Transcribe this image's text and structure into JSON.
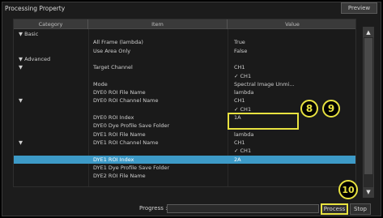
{
  "window": {
    "title": "Processing Property",
    "preview_label": "Preview"
  },
  "grid": {
    "headers": [
      "Category",
      "Item",
      "Value"
    ],
    "rows": [
      {
        "category": "▼ Basic",
        "item": "",
        "value": ""
      },
      {
        "category": "",
        "item": "All Frame (lambda)",
        "value": "True"
      },
      {
        "category": "",
        "item": "Use Area Only",
        "value": "False"
      },
      {
        "category": "▼ Advanced",
        "item": "",
        "value": ""
      },
      {
        "category": "▼",
        "item": "Target Channel",
        "value": "CH1"
      },
      {
        "category": "",
        "item": "",
        "value": "✓ CH1"
      },
      {
        "category": "",
        "item": "Mode",
        "value": "Spectral Image Unmi..."
      },
      {
        "category": "",
        "item": "DYE0  ROI File Name",
        "value": "lambda"
      },
      {
        "category": "▼",
        "item": "DYE0  ROI Channel Name",
        "value": "CH1"
      },
      {
        "category": "",
        "item": "",
        "value": "✓ CH1"
      },
      {
        "category": "",
        "item": "DYE0  ROI Index",
        "value": "1A"
      },
      {
        "category": "",
        "item": "DYE0 Dye Profile Save Folder",
        "value": ""
      },
      {
        "category": "",
        "item": "DYE1  ROI File Name",
        "value": "lambda"
      },
      {
        "category": "▼",
        "item": "DYE1  ROI Channel Name",
        "value": "CH1"
      },
      {
        "category": "",
        "item": "",
        "value": "✓ CH1"
      },
      {
        "category": "",
        "item": "DYE1  ROI Index",
        "value": "2A"
      },
      {
        "category": "",
        "item": "DYE1 Dye Profile Save Folder",
        "value": ""
      },
      {
        "category": "",
        "item": "DYE2  ROI File Name",
        "value": ""
      }
    ],
    "selected_row_index": 15
  },
  "callouts": {
    "c8": "8",
    "c9": "9",
    "c10": "10"
  },
  "footer": {
    "progress_label": "Progress :",
    "process_label": "Process",
    "stop_label": "Stop"
  },
  "colors": {
    "selected_row": "#3d9ac7",
    "callout": "#e8e240"
  },
  "icons": {
    "scroll_up": "triangle-up-icon",
    "scroll_down": "triangle-down-icon"
  }
}
